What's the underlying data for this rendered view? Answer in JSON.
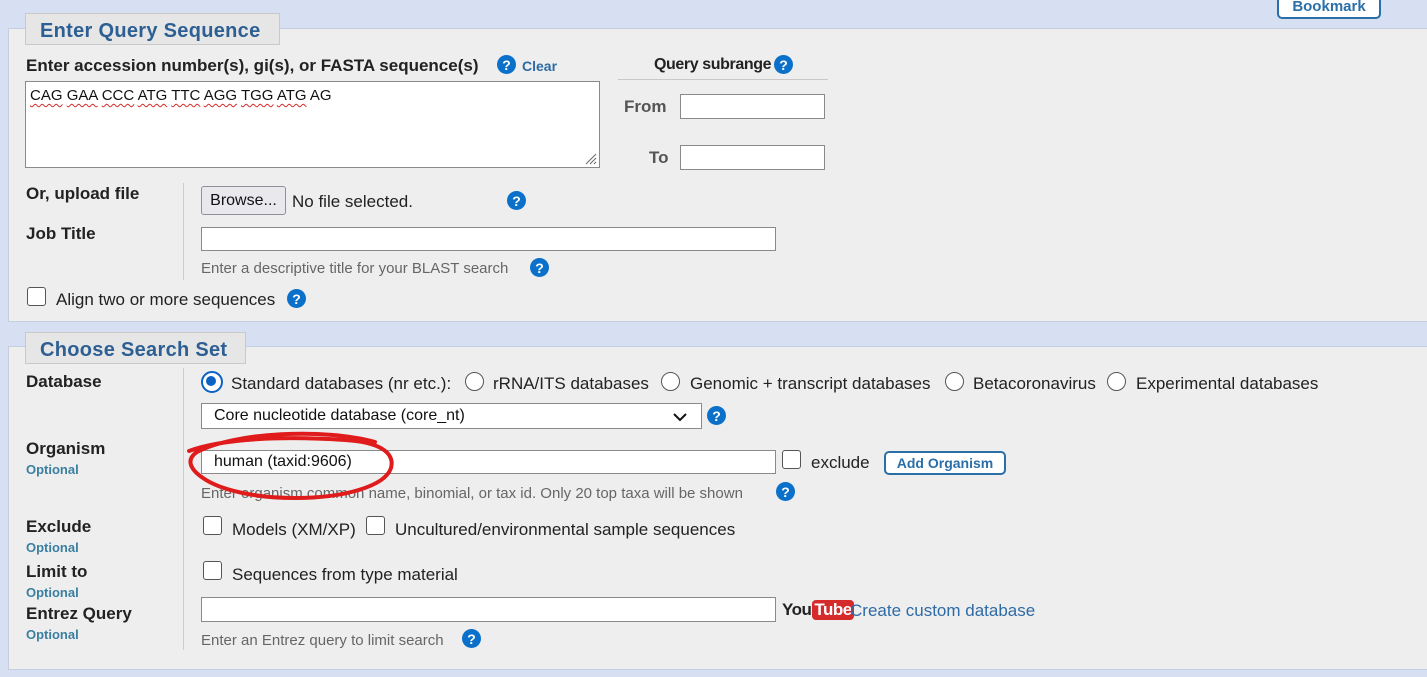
{
  "top": {
    "bookmark_label": "Bookmark"
  },
  "query": {
    "legend": "Enter Query Sequence",
    "seq_label": "Enter accession number(s), gi(s), or FASTA sequence(s)",
    "clear_label": "Clear",
    "sequence_value_words": [
      "CAG",
      "GAA",
      "CCC",
      "ATG",
      "TTC",
      "AGG",
      "TGG",
      "ATG",
      "AG"
    ],
    "subrange_title": "Query subrange",
    "from_label": "From",
    "to_label": "To",
    "from_value": "",
    "to_value": "",
    "upload_label": "Or, upload file",
    "browse_label": "Browse...",
    "no_file_text": "No file selected.",
    "job_title_label": "Job Title",
    "job_title_value": "",
    "job_title_hint": "Enter a descriptive title for your BLAST search",
    "align_label": "Align two or more sequences"
  },
  "search_set": {
    "legend": "Choose Search Set",
    "database_label": "Database",
    "db_options": [
      {
        "label": "Standard databases (nr etc.):",
        "selected": true
      },
      {
        "label": "rRNA/ITS databases",
        "selected": false
      },
      {
        "label": "Genomic + transcript databases",
        "selected": false
      },
      {
        "label": "Betacoronavirus",
        "selected": false
      },
      {
        "label": "Experimental databases",
        "selected": false
      }
    ],
    "db_select_value": "Core nucleotide database (core_nt)",
    "organism_label": "Organism",
    "optional_label": "Optional",
    "organism_value": "human (taxid:9606)",
    "exclude_cb_label": "exclude",
    "add_organism_label": "Add Organism",
    "organism_hint": "Enter organism common name, binomial, or tax id. Only 20 top taxa will be shown",
    "exclude_label": "Exclude",
    "exclude_models_label": "Models (XM/XP)",
    "exclude_uncultured_label": "Uncultured/environmental sample sequences",
    "limit_label": "Limit to",
    "type_material_label": "Sequences from type material",
    "entrez_label": "Entrez Query",
    "entrez_value": "",
    "youtube_you": "You",
    "youtube_tube": "Tube",
    "custom_db_link": "Create custom database",
    "entrez_hint": "Enter an Entrez query to limit search"
  },
  "colors": {
    "page_bg": "#d6e0f2",
    "panel_bg": "#eeeeee",
    "legend_text": "#2d5f93",
    "help_icon": "#0b70c9",
    "annotation_red": "#e01b1b"
  },
  "help_icon_glyph": "?"
}
